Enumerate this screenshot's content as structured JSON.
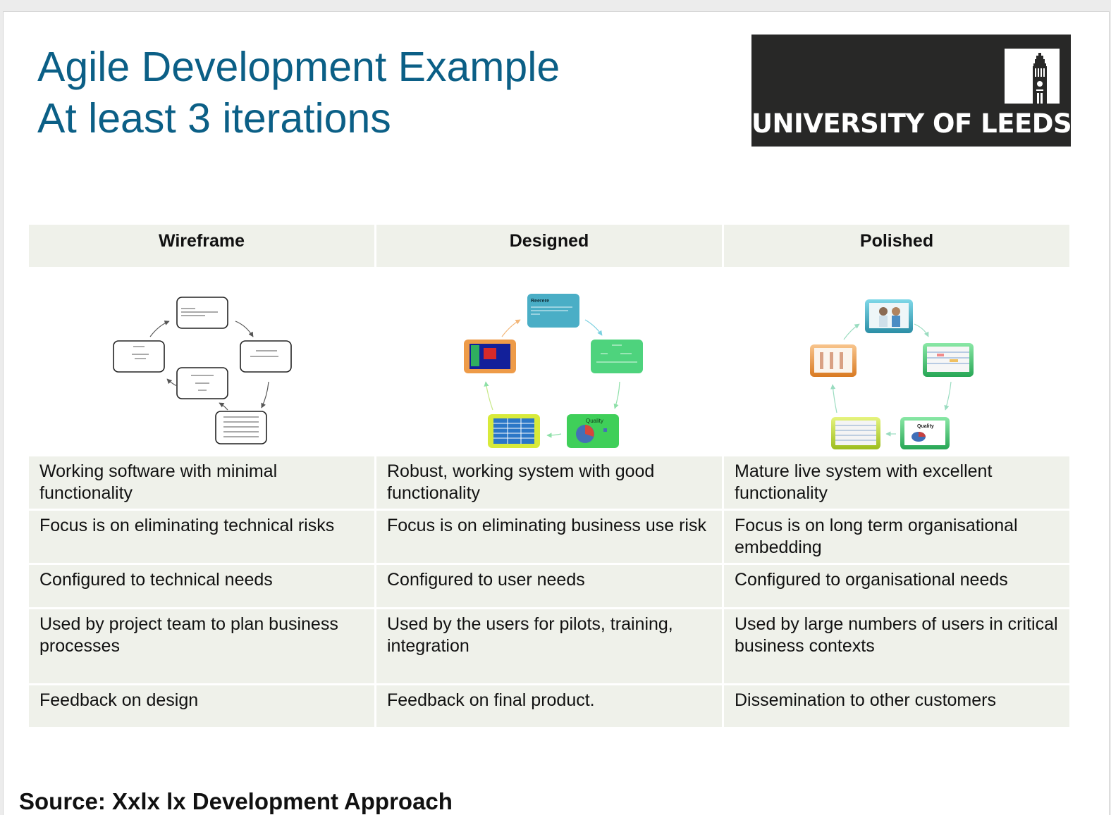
{
  "slide": {
    "title_line1": "Agile Development Example",
    "title_line2": "At least 3 iterations",
    "logo_text": "UNIVERSITY OF LEEDS",
    "bottom_text": "Source: Xxlx lx Development Approach"
  },
  "table": {
    "headers": [
      "Wireframe",
      "Designed",
      "Polished"
    ],
    "image_icons": [
      "wireframe-cycle-diagram-icon",
      "designed-cycle-diagram-icon",
      "polished-cycle-diagram-icon"
    ],
    "diagram_labels": {
      "designed_top": "Reerere",
      "designed_quality": "Quality",
      "polished_quality": "Quality"
    },
    "rows": [
      [
        "Working software with minimal functionality",
        "Robust, working system with good functionality",
        "Mature live system with excellent functionality"
      ],
      [
        "Focus is on eliminating technical risks",
        "Focus is on eliminating business use risk",
        "Focus is on long term organisational embedding"
      ],
      [
        "Configured to technical needs",
        "Configured to user needs",
        "Configured to organisational needs"
      ],
      [
        "Used by project team to plan business processes",
        "Used by the users for pilots, training, integration",
        "Used by large numbers of users in critical business contexts"
      ],
      [
        "Feedback on design",
        "Feedback on final product.",
        "Dissemination to other customers"
      ]
    ]
  },
  "colors": {
    "title": "#0b5f86",
    "logo_bg": "#282827",
    "cell_bg": "#eff1ea",
    "designed_blue": "#4aaec6",
    "designed_green": "#4ed37d",
    "designed_orange": "#ee9b48",
    "designed_yellow": "#d8ea3a"
  }
}
